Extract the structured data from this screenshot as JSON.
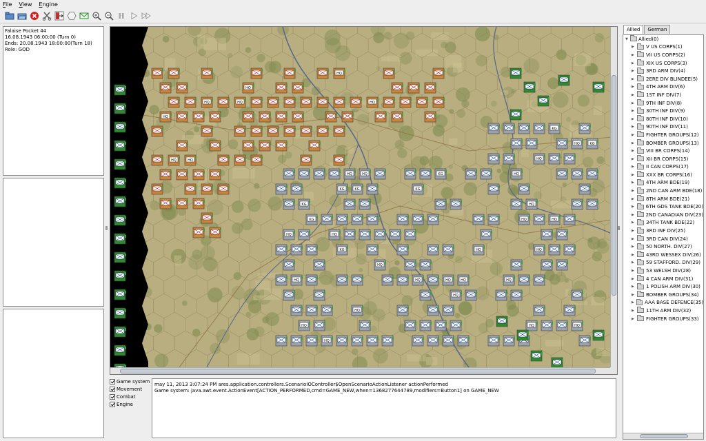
{
  "menu": {
    "items": [
      "File",
      "View",
      "Engine"
    ]
  },
  "toolbar": {
    "buttons": [
      {
        "name": "new-icon",
        "color": "#3a6fb0"
      },
      {
        "name": "open-icon",
        "color": "#3a6fb0"
      },
      {
        "name": "stop-icon",
        "color": "#d02020"
      },
      {
        "name": "cut-icon",
        "color": "#555555"
      },
      {
        "name": "exit-icon",
        "color": "#c03030"
      },
      {
        "name": "hexagon-icon",
        "color": "#888888"
      },
      {
        "name": "mail-icon",
        "color": "#2a8a2a"
      },
      {
        "name": "zoom-in-icon",
        "color": "#555555"
      },
      {
        "name": "zoom-out-icon",
        "color": "#555555"
      },
      {
        "name": "pause-icon",
        "color": "#999999"
      },
      {
        "name": "play-icon",
        "color": "#999999"
      },
      {
        "name": "fast-forward-icon",
        "color": "#999999"
      }
    ]
  },
  "scenario": {
    "title": "Falaise Pocket 44",
    "start": "16.08.1943 06:00:00 (Turn 0)",
    "ends": "Ends: 20.08.1943 18:00:00(Turn 18)",
    "role": "Role: GOD"
  },
  "log": {
    "filters": [
      "Game system",
      "Movement",
      "Combat",
      "Engine"
    ],
    "lines": [
      "may 11, 2013 3:07:24 PM ares.application.controllers.ScenarioIOController$OpenScenarioActionListener actionPerformed",
      "Game system: java.awt.event.ActionEvent[ACTION_PERFORMED,cmd=GAME_NEW,when=1368277644789,modifiers=Button1] on GAME_NEW"
    ]
  },
  "sidebar": {
    "tabs": [
      "Allied",
      "German"
    ],
    "active_tab": "Allied",
    "root": "Allied(0)",
    "items": [
      "V US CORPS(1)",
      "VII US CORPS(2)",
      "XIX US CORPS(3)",
      "3RD ARM DIV(4)",
      "2ERE DIV BLINDEE(5)",
      "4TH ARM DIV(6)",
      "1ST INF DIV(7)",
      "9TH INF DIV(8)",
      "30TH INF DIV(9)",
      "80TH INF DIV(10)",
      "90TH INF DIV(11)",
      "FIGHTER GROUPS(12)",
      "BOMBER GROUPS(13)",
      "VIII BR CORPS(14)",
      "XII BR CORPS(15)",
      "II CAN CORPS(17)",
      "XXX BR CORPS(16)",
      "4TH ARM BDE(19)",
      "2ND CAN ARM BDE(18)",
      "8TH ARM BDE(21)",
      "6TH GDS TANK BDE(20)",
      "2ND CANADIAN DIV(23)",
      "34TH TANK BDE(22)",
      "3RD INF DIV(25)",
      "3RD CAN DIV(24)",
      "50 NORTH. DIV(27)",
      "43RD WESSEX DIV(26)",
      "59 STAFFORD. DIV(29)",
      "53 WELSH DIV(28)",
      "4 CAN ARM DIV(31)",
      "1 POLISH ARM DIV(30)",
      "BOMBER GROUPS(34)",
      "AAA BASE DEFENCE(35)",
      "11TH ARM DIV(32)",
      "FIGHTER GROUPS(33)"
    ]
  },
  "map": {
    "terrain_color": "#b9ae80",
    "forest_color": "#7d8a4e",
    "river_color": "#5a6a8a",
    "counter_colors": {
      "allied": "#c9843a",
      "german": "#9aa3ad",
      "green": "#2f8a2f"
    },
    "unit_labels": [
      "HQ",
      "KG"
    ]
  }
}
